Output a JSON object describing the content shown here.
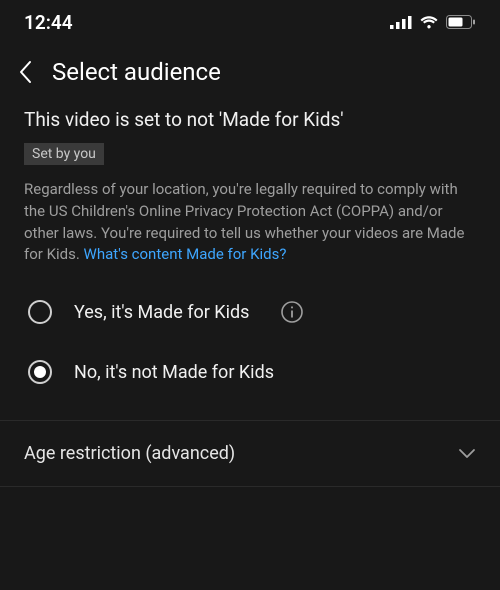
{
  "status_bar": {
    "time": "12:44"
  },
  "header": {
    "title": "Select audience"
  },
  "main": {
    "heading": "This video is set to not 'Made for Kids'",
    "badge": "Set by you",
    "desc_prefix": "Regardless of your location, you're legally required to comply with the US Children's Online Privacy Protection Act (COPPA) and/or other laws. You're required to tell us whether your videos are Made for Kids. ",
    "desc_link": "What's content Made for Kids?",
    "options": [
      {
        "label": "Yes, it's Made for Kids",
        "selected": false,
        "has_info": true
      },
      {
        "label": "No, it's not Made for Kids",
        "selected": true,
        "has_info": false
      }
    ]
  },
  "expander": {
    "label": "Age restriction (advanced)"
  }
}
